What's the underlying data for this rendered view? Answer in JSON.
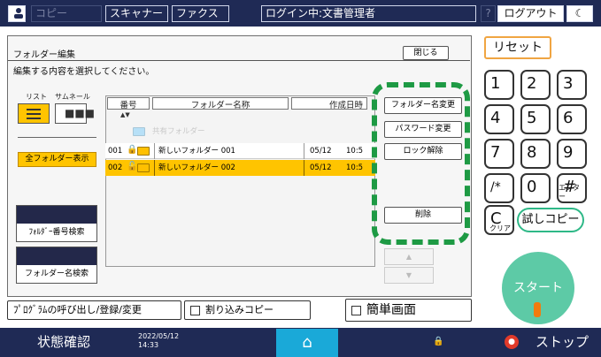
{
  "topbar": {
    "copy": "コピー",
    "scanner": "スキャナー",
    "fax": "ファクス",
    "login": "ログイン中:文書管理者",
    "help": "?",
    "logout": "ログアウト",
    "moon": "☾"
  },
  "window": {
    "title": "フォルダー編集",
    "close": "閉じる",
    "instruction": "編集する内容を選択してください。"
  },
  "view": {
    "list_label": "リスト",
    "thumb_label": "サムネール",
    "show_all": "全フォルダー表示",
    "search_number": "ﾌｫﾙﾀﾞｰ番号検索",
    "search_name": "フォルダー名検索"
  },
  "table": {
    "columns": [
      "番号",
      "フォルダー名称",
      "作成日時"
    ],
    "shared_folder": "共有フォルダー",
    "rows": [
      {
        "num": "001",
        "name": "新しいフォルダー 001",
        "date": "05/12",
        "time": "10:5"
      },
      {
        "num": "002",
        "name": "新しいフォルダー 002",
        "date": "05/12",
        "time": "10:5"
      }
    ]
  },
  "actions": {
    "rename": "フォルダー名変更",
    "password": "パスワード変更",
    "unlock": "ロック解除",
    "delete": "削除",
    "up": "▲",
    "down": "▼"
  },
  "keypad": {
    "reset": "リセット",
    "keys": [
      "1",
      "2",
      "3",
      "4",
      "5",
      "6",
      "7",
      "8",
      "9",
      "/*",
      "0",
      "#"
    ],
    "enter_label": "エンター",
    "clear": "C",
    "clear_label": "クリア",
    "trial_copy": "試しコピー",
    "start": "スタート"
  },
  "functions": {
    "program": "ﾌﾟﾛｸﾞﾗﾑの呼び出し/登録/変更",
    "interrupt": "割り込みコピー",
    "simple": "簡単画面"
  },
  "status": {
    "check": "状態確認",
    "date": "2022/05/12",
    "time": "14:33",
    "stop": "ストップ"
  },
  "colors": {
    "navy": "#1f2a55",
    "selected_yellow": "#ffc400",
    "highlight_green": "#1e9a44",
    "start_green": "#5dcaa6",
    "home_blue": "#1aa9d8"
  }
}
